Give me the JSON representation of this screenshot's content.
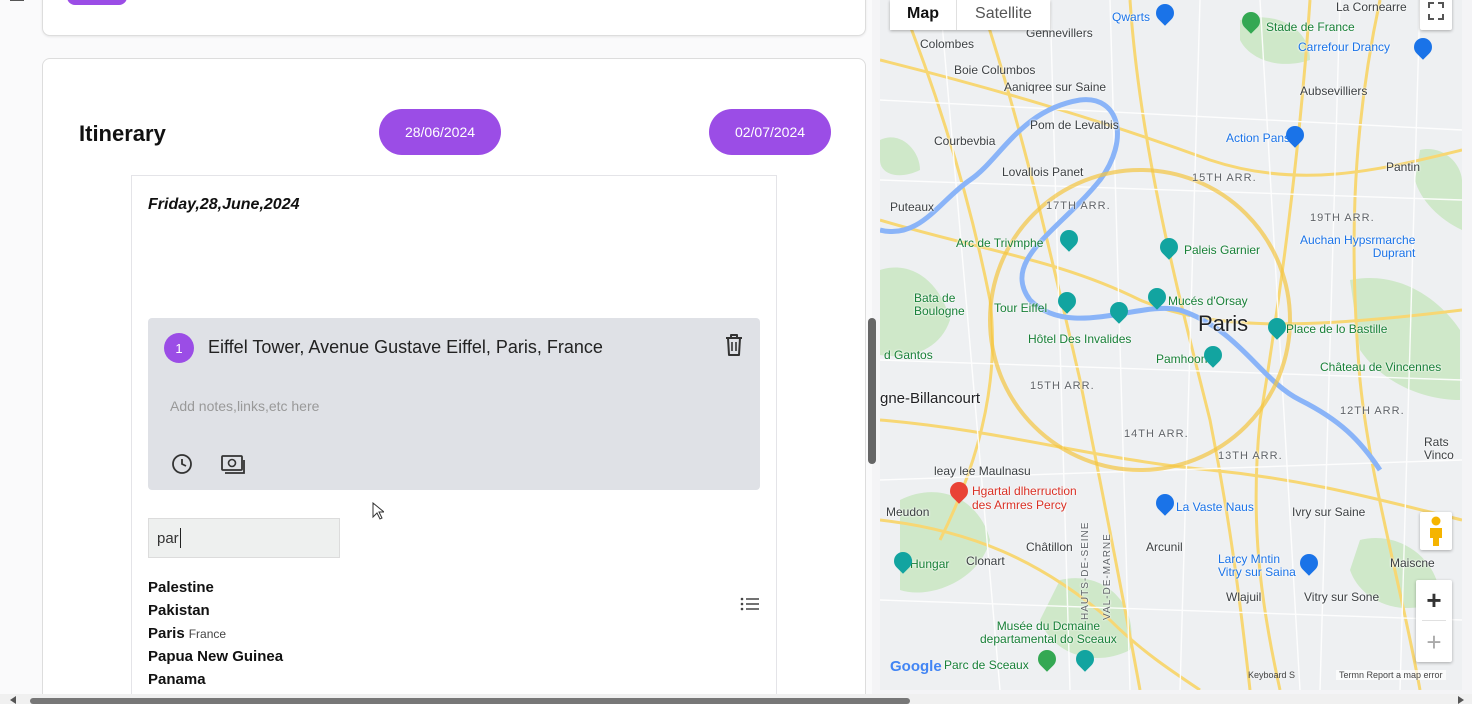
{
  "itinerary": {
    "title": "Itinerary",
    "start_date": "28/06/2024",
    "end_date": "02/07/2024",
    "day_title": "Friday,28,June,2024",
    "place": {
      "number": "1",
      "name": "Eiffel Tower, Avenue Gustave Eiffel, Paris, France",
      "notes_placeholder": "Add notes,links,etc here"
    },
    "search_value": "par",
    "suggestions": [
      {
        "name": "Palestine",
        "sub": ""
      },
      {
        "name": "Pakistan",
        "sub": ""
      },
      {
        "name": "Paris",
        "sub": "France"
      },
      {
        "name": "Papua New Guinea",
        "sub": ""
      },
      {
        "name": "Panama",
        "sub": ""
      }
    ]
  },
  "map": {
    "type_map": "Map",
    "type_satellite": "Satellite",
    "labels": {
      "paris": "Paris",
      "colombes": "Colombes",
      "bois_colombes": "Boie Columbos",
      "asnieres": "Aaniqree sur Saine",
      "gennevilliers": "Gennevillers",
      "courbevoie": "Courbevbia",
      "levallois": "Lovallois Panet",
      "puteaux": "Puteaux",
      "boulogne": "Bata de\nBoulogne",
      "billancourt": "gne-Billancourt",
      "gantos": "d Gantos",
      "issy": "leay lee Maulnasu",
      "meudon": "Meudon",
      "clamart": "Clonart",
      "chatillon": "Châtillon",
      "arcueil": "Arcunil",
      "villejuif": "Wlajuil",
      "vitry": "Vitry sur Sone",
      "ivry": "Ivry sur Saine",
      "aubervilliers": "Aubsevilliers",
      "pantin": "Pantin",
      "la_courneuve": "La Cornearre",
      "montreuil": "Rats\nVinco",
      "maisons": "Maiscne",
      "arr17": "17TH ARR.",
      "arr18": "15TH ARR.",
      "arr19": "19TH ARR.",
      "arr15": "15TH ARR.",
      "arr14": "14TH ARR.",
      "arr13": "13TH ARR.",
      "arr12": "12TH ARR.",
      "arc": "Arc de Trivmphe",
      "eiffel": "Tour Eiffel",
      "invalides": "Hôtel Des Invalides",
      "orsay": "Mucés d'Orsay",
      "pantheon": "Pamhoon",
      "garnier": "Paleis Garnier",
      "bastille": "Place de lo Bastille",
      "vincennes": "Château de Vincennes",
      "qwartz": "Qwarts",
      "stade": "Stade de France",
      "carrefour": "Carrefour Drancy",
      "action": "Action Pans",
      "auchan": "Auchan Hypsrmarche\nDuprant",
      "levallois_pont": "Pom de Levalbis",
      "hopital": "Hgartal dlherruction\ndes Armres Percy",
      "vaste": "La Vaste Naus",
      "larcy": "Larcy Mntin\nVitry sur Saina",
      "musee_sceaux": "Musée du Dcmaine\ndepartamental do Sceaux",
      "parc_sceaux": "Parc de Sceaux",
      "hungar": "Hungar",
      "hauts_seine": "HAUTS-DE-SEINE",
      "val_marne": "VAL-DE-MARNE",
      "footer": "Termn   Report a map error",
      "keyboard": "Keyboard S"
    },
    "google": "Google"
  }
}
